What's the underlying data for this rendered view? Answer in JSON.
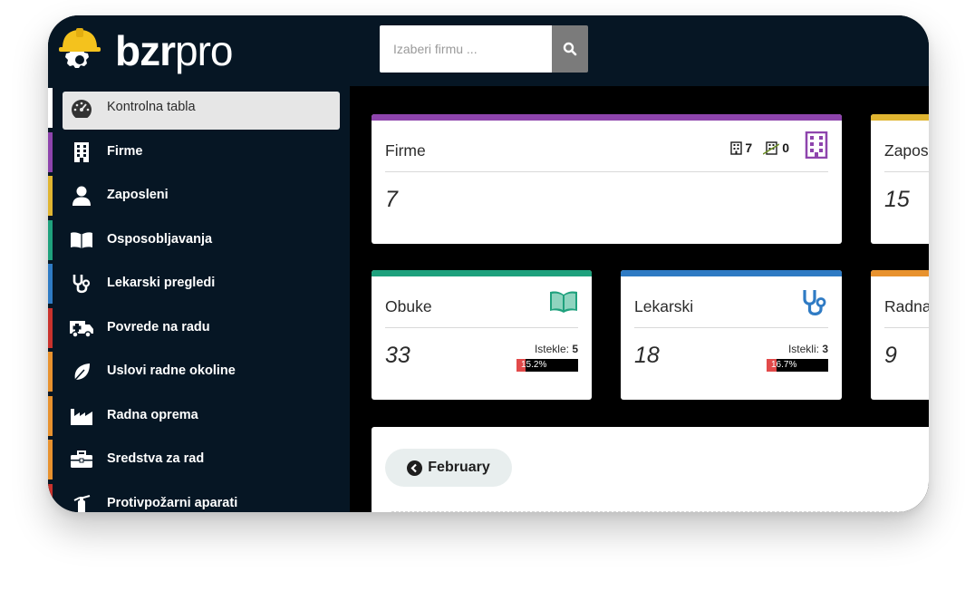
{
  "brand": {
    "bold": "bzr",
    "light": "pro"
  },
  "search": {
    "placeholder": "Izaberi firmu ..."
  },
  "sidebar": {
    "items": [
      {
        "label": "Kontrolna tabla",
        "color": "#ffffff",
        "icon": "dashboard-gauge-icon"
      },
      {
        "label": "Firme",
        "color": "#8e44ad",
        "icon": "building-icon"
      },
      {
        "label": "Zaposleni",
        "color": "#e0b531",
        "icon": "user-icon"
      },
      {
        "label": "Osposobljavanja",
        "color": "#1fa17d",
        "icon": "book-open-icon"
      },
      {
        "label": "Lekarski pregledi",
        "color": "#2f7bc4",
        "icon": "stethoscope-icon"
      },
      {
        "label": "Povrede na radu",
        "color": "#c9322d",
        "icon": "ambulance-icon"
      },
      {
        "label": "Uslovi radne okoline",
        "color": "#e8922e",
        "icon": "leaf-icon"
      },
      {
        "label": "Radna oprema",
        "color": "#e8922e",
        "icon": "factory-icon"
      },
      {
        "label": "Sredstva za rad",
        "color": "#e8922e",
        "icon": "briefcase-icon"
      },
      {
        "label": "Protivpožarni aparati",
        "color": "#c9322d",
        "icon": "fire-extinguisher-icon"
      }
    ]
  },
  "cards": {
    "firme": {
      "title": "Firme",
      "value": "7",
      "active_count": "7",
      "inactive_count": "0",
      "color": "#8e44ad"
    },
    "zaposleni": {
      "title": "Zapos",
      "value": "15",
      "color": "#e0b531"
    },
    "obuke": {
      "title": "Obuke",
      "value": "33",
      "expired_label": "Istekle:",
      "expired_count": "5",
      "percent": "15.2%",
      "percent_value": 15.2,
      "color": "#1fa17d"
    },
    "lekarski": {
      "title": "Lekarski",
      "value": "18",
      "expired_label": "Istekli:",
      "expired_count": "3",
      "percent": "16.7%",
      "percent_value": 16.7,
      "color": "#2f7bc4"
    },
    "radna": {
      "title": "Radna",
      "value": "9",
      "color": "#e8922e"
    }
  },
  "calendar": {
    "month_button": "February"
  }
}
